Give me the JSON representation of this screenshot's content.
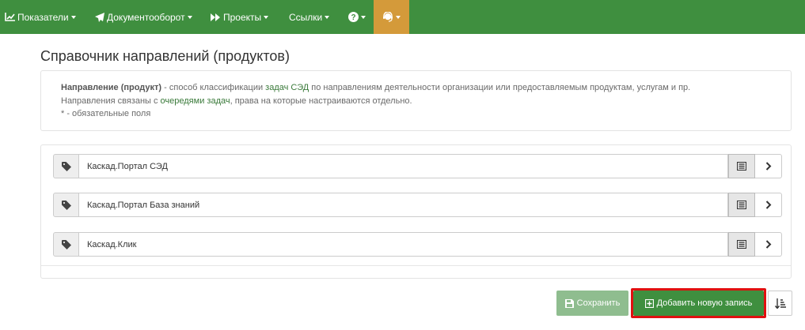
{
  "navbar": {
    "bg_color": "#3f8f3f",
    "active_color": "#d49a3a",
    "items": [
      {
        "label": "Показатели",
        "icon": "chart-line-icon"
      },
      {
        "label": "Документооборот",
        "icon": "paper-plane-icon"
      },
      {
        "label": "Проекты",
        "icon": "fast-forward-icon"
      },
      {
        "label": "Ссылки",
        "icon": ""
      },
      {
        "label": "",
        "icon": "question-circle-icon"
      },
      {
        "label": "",
        "icon": "support-agent-icon"
      }
    ]
  },
  "page": {
    "title": "Справочник направлений (продуктов)"
  },
  "info": {
    "line1_bold": "Направление (продукт)",
    "line1_a": " - способ классификации ",
    "line1_link": "задач СЭД",
    "line1_b": " по направлениям деятельности организации или предоставляемым продуктам, услугам и пр.",
    "line2_a": "Направления связаны с ",
    "line2_link": "очередями задач",
    "line2_b": ", права на которые настраиваются отдельно.",
    "line3": "* - обязательные поля"
  },
  "directions": [
    {
      "name": "Каскад.Портал СЭД"
    },
    {
      "name": "Каскад.Портал База знаний"
    },
    {
      "name": "Каскад.Клик"
    }
  ],
  "actions": {
    "save_label": "Сохранить",
    "add_label": "Добавить новую запись"
  }
}
